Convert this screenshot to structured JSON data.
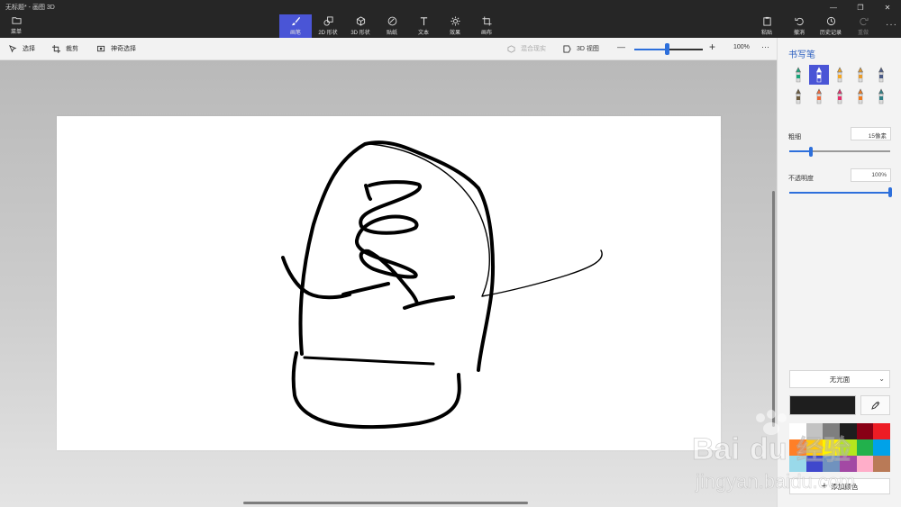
{
  "window": {
    "title": "无标题* - 画图 3D",
    "controls": [
      "—",
      "❐",
      "✕"
    ]
  },
  "menu": {
    "label": "菜单"
  },
  "toolbar": {
    "tools": [
      {
        "id": "brush",
        "label": "画笔",
        "active": true
      },
      {
        "id": "shapes2d",
        "label": "2D 形状",
        "active": false
      },
      {
        "id": "shapes3d",
        "label": "3D 形状",
        "active": false
      },
      {
        "id": "stickers",
        "label": "贴纸",
        "active": false
      },
      {
        "id": "text",
        "label": "文本",
        "active": false
      },
      {
        "id": "effects",
        "label": "效果",
        "active": false
      },
      {
        "id": "canvas",
        "label": "画布",
        "active": false
      }
    ],
    "right": [
      {
        "id": "paste",
        "label": "粘贴",
        "disabled": false
      },
      {
        "id": "undo",
        "label": "撤消",
        "disabled": false
      },
      {
        "id": "history",
        "label": "历史记录",
        "disabled": false
      },
      {
        "id": "redo",
        "label": "重做",
        "disabled": true
      }
    ],
    "more": "···"
  },
  "subbar": {
    "select": "选择",
    "crop": "裁剪",
    "magic_select": "神奇选择",
    "mixed_reality": "混合现实",
    "view_3d": "3D 视图",
    "zoom_minus": "—",
    "zoom_plus": "+",
    "zoom_value": "100%",
    "zoom_level": 0.48,
    "more": "···"
  },
  "panel": {
    "title": "书写笔",
    "pens": [
      {
        "name": "marker-icon",
        "color": "#1aa37a"
      },
      {
        "name": "calligraphy-pen-icon",
        "color": "#ffffff",
        "selected": true
      },
      {
        "name": "oil-brush-icon",
        "color": "#f5a623"
      },
      {
        "name": "watercolor-icon",
        "color": "#e89b2c"
      },
      {
        "name": "pixel-pen-icon",
        "color": "#4a5a86"
      },
      {
        "name": "pencil-icon",
        "color": "#6b5a3e"
      },
      {
        "name": "eraser-icon",
        "color": "#f06a3c"
      },
      {
        "name": "crayon-icon",
        "color": "#e52f6b"
      },
      {
        "name": "spray-can-icon",
        "color": "#f07b21"
      },
      {
        "name": "fill-icon",
        "color": "#2f7f86"
      }
    ],
    "thickness": {
      "label": "粗细",
      "value": "15像素",
      "level": 0.21
    },
    "opacity": {
      "label": "不透明度",
      "value": "100%",
      "level": 1.0
    },
    "finish": {
      "label": "无光面"
    },
    "current_color": "#1e1e1e",
    "swatches": [
      "#ffffff",
      "#c3c3c3",
      "#7f7f7f",
      "#1e1e1e",
      "#880015",
      "#ed1c24",
      "#ff7f27",
      "#ffc90e",
      "#fff200",
      "#b5e61d",
      "#22b14c",
      "#00a2e8",
      "#99d9ea",
      "#3f48cc",
      "#7092be",
      "#a349a4",
      "#ffaec9",
      "#b97a57"
    ],
    "add_color": {
      "plus": "+",
      "label": "添加颜色"
    }
  },
  "watermark": {
    "brand": "Bai",
    "brand2": "du",
    "cn": "经验",
    "url": "jingyan.baidu.com"
  }
}
